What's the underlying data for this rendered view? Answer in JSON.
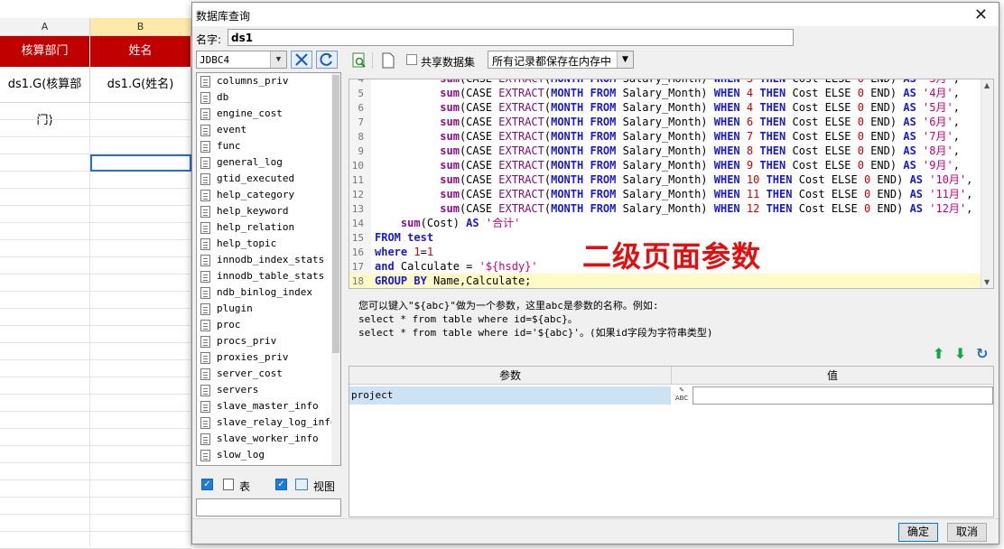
{
  "spreadsheet": {
    "col_a": "A",
    "col_b": "B",
    "header_a": "核算部门",
    "header_b": "姓名",
    "cell_a": "ds1.G(核算部门)",
    "cell_b": "ds1.G(姓名)"
  },
  "dialog": {
    "title": "数据库查询",
    "name_label": "名字:",
    "name_value": "ds1",
    "connection": "JDBC4",
    "tables": [
      "columns_priv",
      "db",
      "engine_cost",
      "event",
      "func",
      "general_log",
      "gtid_executed",
      "help_category",
      "help_keyword",
      "help_relation",
      "help_topic",
      "innodb_index_stats",
      "innodb_table_stats",
      "ndb_binlog_index",
      "plugin",
      "proc",
      "procs_priv",
      "proxies_priv",
      "server_cost",
      "servers",
      "slave_master_info",
      "slave_relay_log_info",
      "slave_worker_info",
      "slow_log"
    ],
    "checkbox_table": "表",
    "checkbox_view": "视图",
    "share_label": "共享数据集",
    "memory_mode": "所有记录都保存在内存中",
    "overlay_annotation": "二级页面参数",
    "hint": [
      "您可以键入\"${abc}\"做为一个参数，这里abc是参数的名称。例如:",
      "select * from table where id=${abc}。",
      "select * from table where id='${abc}'。(如果id字段为字符串类型)"
    ],
    "param_header": "参数",
    "value_header": "值",
    "param_name": "project",
    "param_type": "ABC",
    "param_value": "",
    "ok": "确定",
    "cancel": "取消"
  }
}
